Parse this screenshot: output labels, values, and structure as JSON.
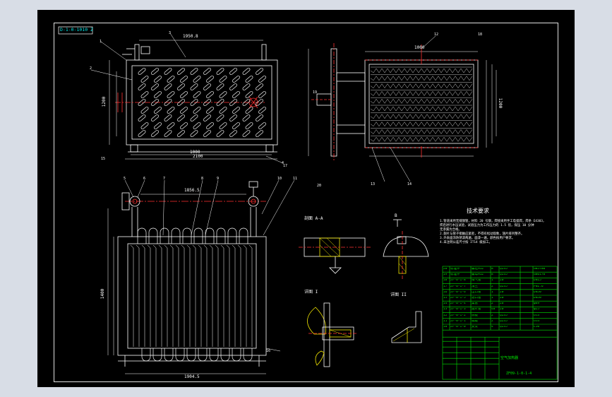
{
  "drawing_code": "D-1-0-1010 Z",
  "notes_title": "技术要求",
  "notes_lines": [
    "1.管道采用无缝钢管，材料 20 号钢，焊接采用手工电弧焊，焊条 E4303，",
    "  焊后进行水压试验，试验压力为工作压力的 1.5 倍，保压 10 分钟",
    "  无渗漏为合格。",
    "2.翅片与管子接触应紧密，不得有松动现象，翅片排列整齐。",
    "3.外表面涂防锈漆两遍，面漆一遍，颜色按用户要求。",
    "4.未注明公差尺寸按 IT14 级加工。"
  ],
  "section_labels": {
    "section_aa": "剖面 A-A",
    "section_bb": "B",
    "detail_1": "详图 I",
    "detail_2": "详图 II"
  },
  "dims": {
    "top_width": "1950.8",
    "top_total": "2100",
    "top_height": "1200",
    "right_width": "1000",
    "right_height": "1200",
    "bottom_width": "1904.5",
    "bottom_height": "1400",
    "bottom_total": "2100",
    "bottom_top": "1856.5"
  },
  "balloons": [
    "1",
    "2",
    "3",
    "4",
    "5",
    "6",
    "7",
    "8",
    "9",
    "10",
    "11",
    "12",
    "13",
    "14",
    "15",
    "16",
    "17",
    "18",
    "19",
    "20"
  ],
  "title_block": {
    "drawing_name": "空气加热器",
    "drawing_number": "ZF09-1-0-1-4",
    "rows": [
      [
        "20",
        "标准件",
        "螺栓M12",
        "8",
        "Q235",
        "",
        "GB5780"
      ],
      [
        "19",
        "标准件",
        "螺母M12",
        "8",
        "Q235",
        "",
        "GB6170"
      ],
      [
        "18",
        "ZF-0-1-8",
        "排气管",
        "1",
        "20",
        "",
        "DN15"
      ],
      [
        "17",
        "ZF-0-1-7",
        "法兰",
        "2",
        "Q235",
        "",
        "PN1.6"
      ],
      [
        "16",
        "ZF-0-1-6",
        "出口管",
        "1",
        "20",
        "",
        "DN50"
      ],
      [
        "15",
        "ZF-0-1-5",
        "进口管",
        "1",
        "20",
        "",
        "DN50"
      ],
      [
        "14",
        "ZF-0-1-4",
        "集管",
        "2",
        "20",
        "",
        "φ89"
      ],
      [
        "13",
        "ZF-0-1-3",
        "翅片管",
        "48",
        "20",
        "",
        "φ25"
      ],
      [
        "12",
        "ZF-0-1-2",
        "侧板",
        "2",
        "Q235",
        "",
        "δ=3"
      ],
      [
        "11",
        "ZF-0-1-1",
        "端板",
        "2",
        "Q235",
        "",
        "δ=4"
      ],
      [
        "10",
        "ZF-0-1-0",
        "支架",
        "4",
        "Q235",
        "",
        "L50"
      ]
    ]
  }
}
